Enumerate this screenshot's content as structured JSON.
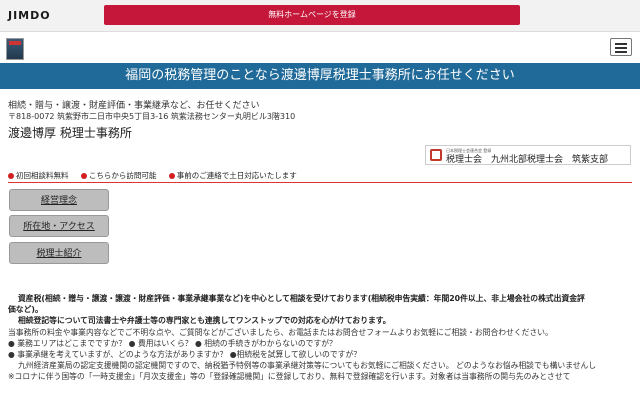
{
  "topbar": {
    "logo": "JIMDO",
    "register_button": "無料ホームページを登録"
  },
  "banner": {
    "title": "福岡の税務管理のことなら渡邊博厚税理士事務所にお任せください"
  },
  "header": {
    "subtitle": "相続・贈与・譲渡・財産評価・事業継承など、お任せください",
    "address": "〒818-0072 筑紫野市二日市中央5丁目3-16 筑紫法務センター丸明ビル3階310",
    "office_name": "渡邊博厚 税理士事務所"
  },
  "zeirishi": {
    "small_text": "日本税理士会連合会 登録",
    "main_text": "税理士会　九州北部税理士会　筑紫支部"
  },
  "info": {
    "items": [
      "初回相談料無料",
      "こちらから訪問可能",
      "事前のご連絡で土日対応いたします"
    ]
  },
  "nav": {
    "items": [
      "経営理念",
      "所在地・アクセス",
      "税理士紹介"
    ]
  },
  "body": {
    "lines": [
      "資産税(相続・贈与・譲渡・譲渡・財産評価・事業承継事業など)を中心として相談を受けております(相続税申告実績：年間20件以上、非上場会社の株式出資金評",
      "価など)。",
      "相続登記等について司法書士や弁護士等の専門家とも連携してワンストップでの対応を心がけております。",
      "当事務所の料金や事業内容などでご不明な点や、ご質問などがございましたら、お電話またはお問合せフォームよりお気軽にご相談・お問合わせください。",
      "● 業務エリアはどこまでですか？ ● 費用はいくら？ ● 相続の手続きがわからないのですが？",
      "● 事業承継を考えていますが、どのような方法がありますか？ ●相続税を試算して欲しいのですが？",
      "九州経済産業局の認定支援機関の認定機関ですので、納税猶予特例等の事業承継対策等についてもお気軽にご相談ください。 どのようなお悩み相談でも構いませんし",
      "※コロナに伴う国等の「一時支援金」「月次支援金」等の「登録確認機関」に登録しており、無料で登録確認を行います。対象者は当事務所の関与先のみとさせて"
    ]
  }
}
